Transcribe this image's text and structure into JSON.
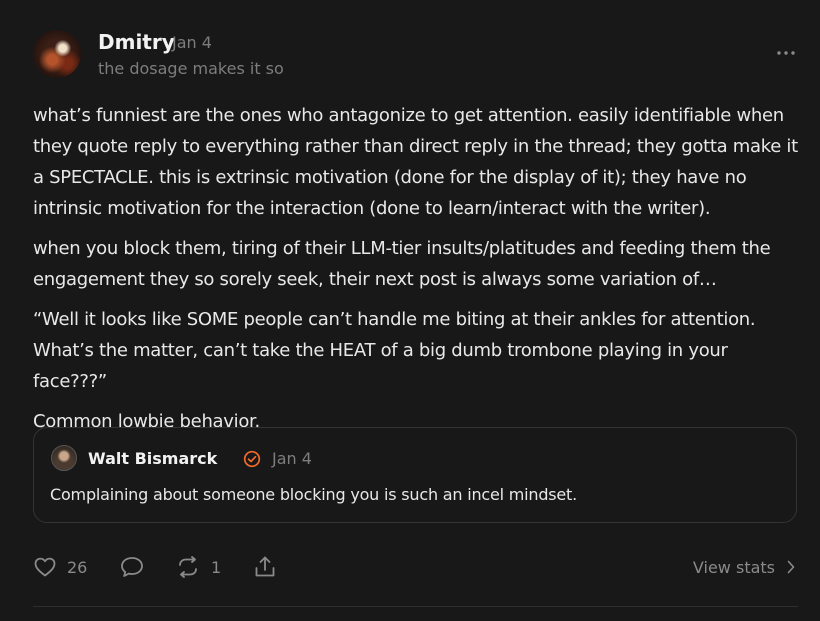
{
  "post": {
    "author": "Dmitry",
    "date": "Jan 4",
    "subtitle": "the dosage makes it so",
    "avatar_icon": "avatar",
    "more_icon": "more-options-icon",
    "body": [
      "what’s funniest are the ones who antagonize to get attention. easily identifiable when they quote reply to everything rather than direct reply in the thread; they gotta make it a SPECTACLE. this is extrinsic motivation (done for the display of it); they have no intrinsic motivation for the interaction (done to learn/interact with the writer).",
      "when you block them, tiring of their LLM-tier insults/platitudes and feeding them the engagement they so sorely seek, their next post is always some variation of…",
      "“Well it looks like SOME people can’t handle me biting at their ankles for attention. What’s the matter, can’t take the HEAT of a big dumb trombone playing in your face???”",
      "Common lowbie behavior."
    ]
  },
  "quote": {
    "author": "Walt Bismarck",
    "date": "Jan 4",
    "text": "Complaining about someone blocking you is such an incel mindset.",
    "verified_color": "#f26b2b"
  },
  "actions": {
    "likes": "26",
    "comment_count": "",
    "restacks": "1",
    "view_stats": "View stats"
  },
  "colors": {
    "background": "#181818",
    "text": "#ececec",
    "muted": "#7d7d7d",
    "accent": "#f26b2b"
  }
}
